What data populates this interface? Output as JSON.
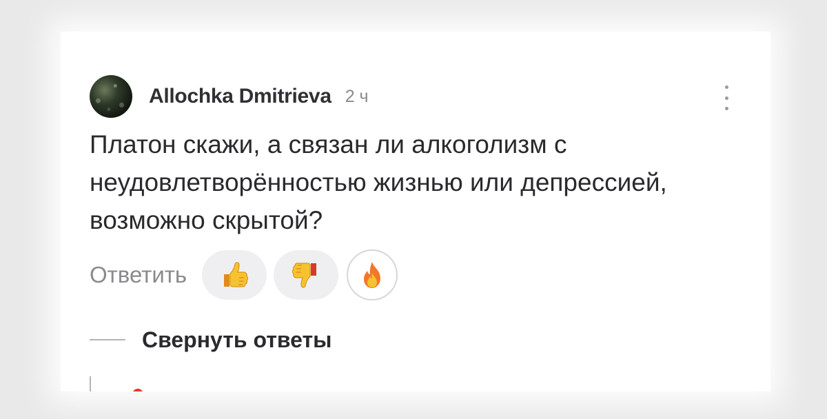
{
  "comment": {
    "author": "Allochka Dmitrieva",
    "time": "2 ч",
    "text": "Платон скажи, а связан ли алкоголизм с неудовлетворённостью жизнью или депрессией, возможно скрытой?",
    "reply_label": "Ответить",
    "reactions": [
      {
        "icon": "thumbs-up-icon"
      },
      {
        "icon": "thumbs-down-icon"
      },
      {
        "icon": "fire-icon"
      }
    ],
    "collapse_label": "Свернуть ответы",
    "menu_icon": "more-vertical-icon"
  }
}
